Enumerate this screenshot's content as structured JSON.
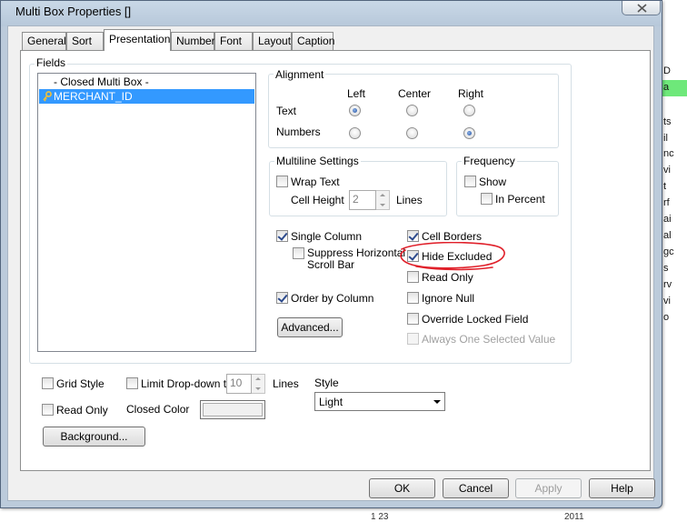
{
  "window": {
    "title": "Multi Box Properties []"
  },
  "tabs": [
    "General",
    "Sort",
    "Presentation",
    "Number",
    "Font",
    "Layout",
    "Caption"
  ],
  "fields": {
    "label": "Fields",
    "items": [
      "- Closed Multi Box -",
      "MERCHANT_ID"
    ],
    "selected": "MERCHANT_ID"
  },
  "alignment": {
    "label": "Alignment",
    "columns": [
      "Left",
      "Center",
      "Right"
    ],
    "rows": [
      {
        "label": "Text",
        "selected": "Left"
      },
      {
        "label": "Numbers",
        "selected": "Right"
      }
    ]
  },
  "multiline": {
    "label": "Multiline Settings",
    "wrap_text": "Wrap Text",
    "wrap_checked": false,
    "cell_height_label": "Cell Height",
    "cell_height_value": "2",
    "lines_label": "Lines"
  },
  "frequency": {
    "label": "Frequency",
    "show": "Show",
    "in_percent": "In Percent"
  },
  "options": {
    "single_column": "Single Column",
    "suppress_horizontal": "Suppress Horizontal",
    "scroll_bar": "Scroll Bar",
    "order_by_column": "Order by Column",
    "cell_borders": "Cell Borders",
    "hide_excluded": "Hide Excluded",
    "read_only": "Read Only",
    "ignore_null": "Ignore Null",
    "override_locked": "Override Locked Field",
    "always_one": "Always One Selected Value",
    "advanced_button": "Advanced..."
  },
  "bottom": {
    "grid_style": "Grid Style",
    "limit_dropdown": "Limit Drop-down to",
    "limit_value": "10",
    "lines": "Lines",
    "style_label": "Style",
    "style_value": "Light",
    "read_only": "Read Only",
    "closed_color": "Closed Color",
    "background_button": "Background..."
  },
  "buttons": {
    "ok": "OK",
    "cancel": "Cancel",
    "apply": "Apply",
    "help": "Help"
  },
  "background_app": {
    "cells": [
      "D",
      "a",
      "ts",
      "il",
      "nc",
      "vi",
      "t",
      "rf",
      "ai",
      "al",
      "gc",
      "s",
      "rv",
      "vi",
      "o"
    ],
    "bottom_left": "1 23",
    "bottom_right": "2011"
  },
  "colors": {
    "selection": "#3399ff",
    "annotation": "#e0202a",
    "highlight_green": "#6ee87a"
  }
}
